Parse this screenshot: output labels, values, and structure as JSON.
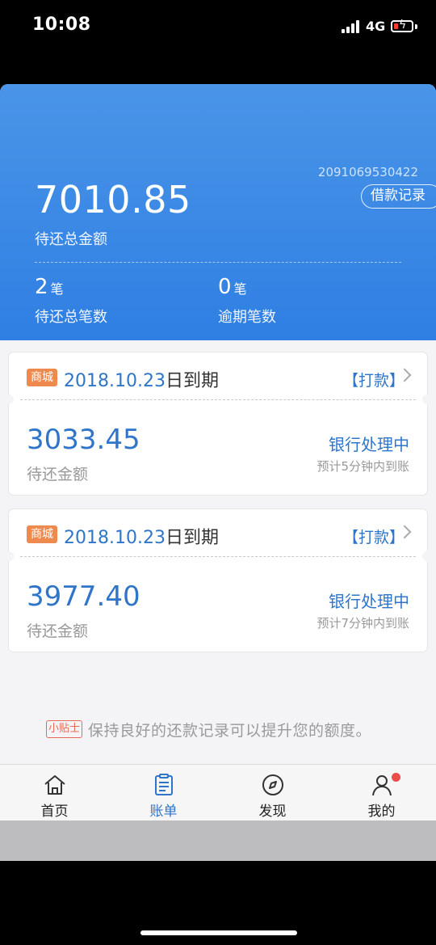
{
  "status_bar": {
    "time": "10:08",
    "network": "4G"
  },
  "header": {
    "account_no": "2091069530422",
    "loan_record_button": "借款记录",
    "total_amount": "7010.85",
    "total_label": "待还总金额",
    "pending_count": "2",
    "pending_unit": "笔",
    "pending_label": "待还总笔数",
    "overdue_count": "0",
    "overdue_unit": "笔",
    "overdue_label": "逾期笔数"
  },
  "bills": [
    {
      "tag": "商城",
      "due_date": "2018.10.23",
      "due_suffix": "日到期",
      "action": "【打款】",
      "amount": "3033.45",
      "amount_label": "待还金额",
      "status": "银行处理中",
      "eta": "预计5分钟内到账"
    },
    {
      "tag": "商城",
      "due_date": "2018.10.23",
      "due_suffix": "日到期",
      "action": "【打款】",
      "amount": "3977.40",
      "amount_label": "待还金额",
      "status": "银行处理中",
      "eta": "预计7分钟内到账"
    }
  ],
  "tip": {
    "badge": "小贴士",
    "text": "保持良好的还款记录可以提升您的额度。"
  },
  "tabs": [
    {
      "label": "首页",
      "icon": "home-icon",
      "active": false
    },
    {
      "label": "账单",
      "icon": "bill-icon",
      "active": true
    },
    {
      "label": "发现",
      "icon": "compass-icon",
      "active": false
    },
    {
      "label": "我的",
      "icon": "profile-icon",
      "active": false,
      "badge_dot": true
    }
  ],
  "colors": {
    "header_blue": "#2f7fe3",
    "accent_blue": "#2f75c9",
    "tag_orange": "#ef8a4e",
    "tip_red": "#e86a56",
    "dot_red": "#ef4c4c"
  }
}
